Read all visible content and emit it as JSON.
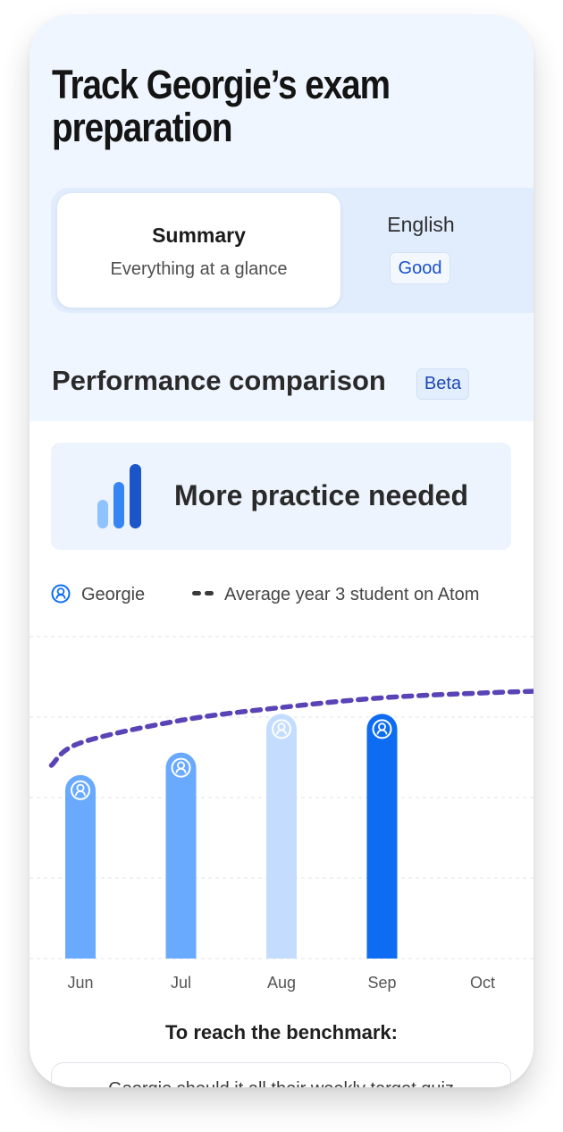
{
  "header": {
    "title": "Track Georgie’s exam preparation"
  },
  "tabs": [
    {
      "title": "Summary",
      "subtitle": "Everything at a glance"
    },
    {
      "title": "English",
      "badge": "Good"
    }
  ],
  "section": {
    "title": "Performance comparison",
    "badge": "Beta"
  },
  "status_card": {
    "text": "More practice needed",
    "icon": "bar-chart-icon"
  },
  "legend": {
    "georgie": {
      "label": "Georgie",
      "icon": "user-icon"
    },
    "average": {
      "label": "Average year 3 student on Atom",
      "icon": "dashed-line-icon"
    }
  },
  "colors": {
    "accent": "#0d6cf2",
    "bar_light": "#69aaff",
    "bar_faded": "#c4ddff",
    "average_line": "#5a43b6"
  },
  "chart_data": {
    "type": "bar",
    "categories": [
      "Jun",
      "Jul",
      "Aug",
      "Sep",
      "Oct"
    ],
    "series": [
      {
        "values": [
          57,
          64,
          76,
          76,
          null
        ],
        "colors": [
          "#69aaff",
          "#69aaff",
          "#c4ddff",
          "#0d6cf2",
          null
        ]
      }
    ],
    "average_line": [
      {
        "x": "May",
        "y": 60
      },
      {
        "x": "Jun",
        "y": 67
      },
      {
        "x": "Jul",
        "y": 74
      },
      {
        "x": "Aug",
        "y": 78
      },
      {
        "x": "Sep",
        "y": 81
      },
      {
        "x": "Oct",
        "y": 82.5
      },
      {
        "x": "Nov",
        "y": 83.5
      }
    ],
    "ylim": [
      0,
      100
    ],
    "grid": true,
    "title": "",
    "xlabel": "",
    "ylabel": ""
  },
  "benchmark": {
    "title": "To reach the benchmark:",
    "text": "Georgie should it all their weekly target quiz"
  }
}
